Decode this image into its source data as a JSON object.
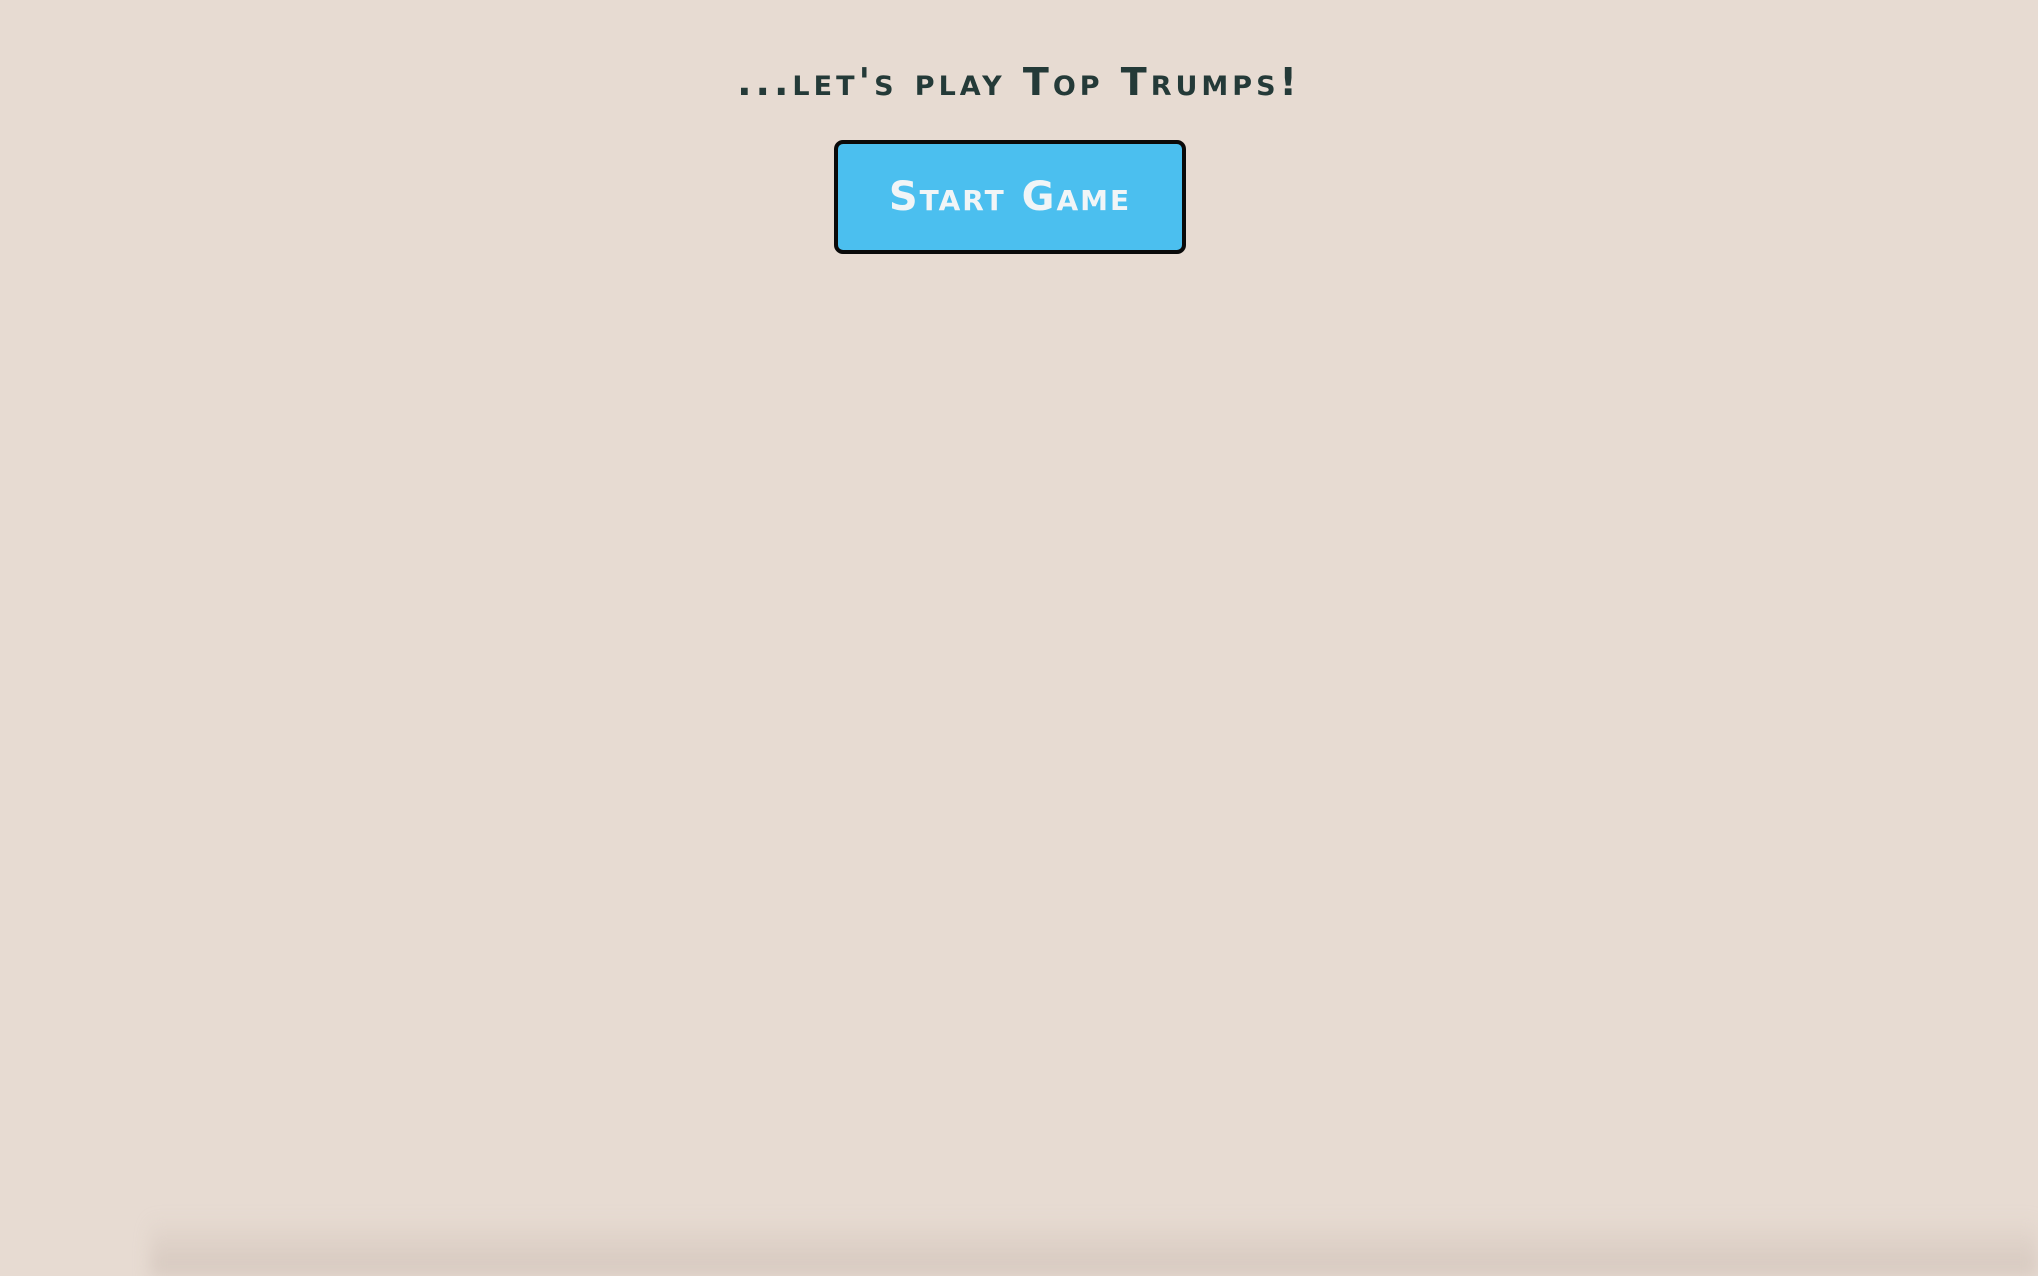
{
  "intro": {
    "headline": "...let's play Top Trumps!",
    "start_button_label": "Start Game"
  },
  "colors": {
    "background": "#e7dbd2",
    "headline_text": "#243a38",
    "button_fill": "#4bbfef",
    "button_border": "#0a0a0a",
    "button_text": "#f1f5f7"
  }
}
